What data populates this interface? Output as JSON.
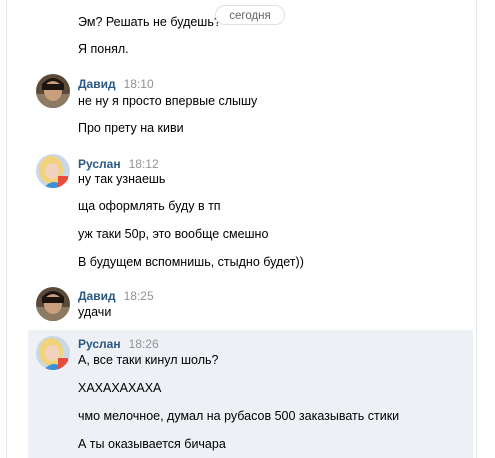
{
  "date_divider": "сегодня",
  "top_messages": [
    "Эм? Решать не будешь?",
    "Я понял."
  ],
  "groups": [
    {
      "author": "Давид",
      "time": "18:10",
      "avatar": "dark-hair-avatar",
      "lines": [
        "не ну я просто впервые слышу",
        "Про прету на киви"
      ]
    },
    {
      "author": "Руслан",
      "time": "18:12",
      "avatar": "blonde-girl-avatar",
      "lines": [
        "ну так узнаешь",
        "ща оформлять буду в тп",
        "уж таки 50р, это вообще смешно",
        "В будущем вспомнишь, стыдно будет))"
      ]
    },
    {
      "author": "Давид",
      "time": "18:25",
      "avatar": "dark-hair-avatar",
      "lines": [
        "удачи"
      ]
    },
    {
      "author": "Руслан",
      "time": "18:26",
      "avatar": "blonde-girl-avatar",
      "lines": [
        "А, все таки кинул шоль?",
        "ХАХАХАХАХА",
        "чмо мелочное, думал на рубасов 500 заказывать стики",
        "А ты оказывается бичара"
      ]
    }
  ],
  "colors": {
    "author_name": "#2a5885",
    "time": "#939393",
    "highlight_bg": "#edf0f5",
    "text": "#000000"
  }
}
